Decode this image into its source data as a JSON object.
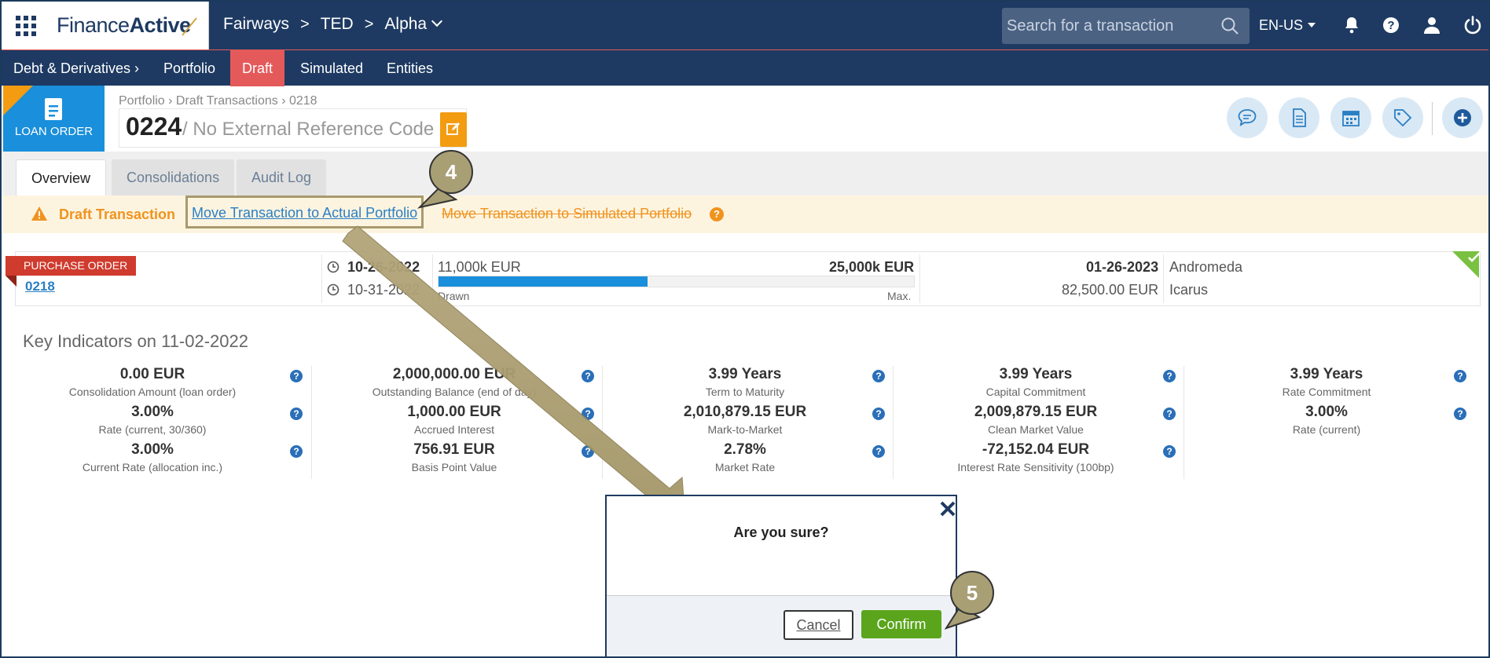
{
  "header": {
    "logo": {
      "finance": "Finance",
      "active": "Active"
    },
    "breadcrumb": [
      "Fairways",
      "TED",
      "Alpha"
    ],
    "search_placeholder": "Search for a transaction",
    "language": "EN-US"
  },
  "nav": {
    "items": [
      {
        "label": "Debt & Derivatives ›"
      },
      {
        "label": "Portfolio"
      },
      {
        "label": "Draft"
      },
      {
        "label": "Simulated"
      },
      {
        "label": "Entities"
      }
    ],
    "active": "Draft"
  },
  "page": {
    "type_label": "LOAN ORDER",
    "breadcrumb": "Portfolio › Draft Transactions ›  0218",
    "number": "0224",
    "reference": "/ No External Reference Code"
  },
  "tabs": [
    {
      "label": "Overview"
    },
    {
      "label": "Consolidations"
    },
    {
      "label": "Audit Log"
    }
  ],
  "active_tab": "Overview",
  "draft_banner": {
    "label": "Draft Transaction",
    "move_actual": "Move Transaction to Actual Portfolio",
    "move_simulated": "Move Transaction to Simulated Portfolio"
  },
  "purchase_order": {
    "ribbon": "PURCHASE ORDER",
    "number": "0218",
    "start_date": "10-26-2022",
    "second_date": "10-31-2022",
    "drawn_amount": "11,000k EUR",
    "max_amount": "25,000k EUR",
    "drawn_label": "Drawn",
    "max_label": "Max.",
    "drawn_fraction": 0.44,
    "end_date": "01-26-2023",
    "amount": "82,500.00 EUR",
    "entity_1": "Andromeda",
    "entity_2": "Icarus"
  },
  "key_indicators": {
    "title": "Key Indicators on 11-02-2022",
    "columns": [
      [
        {
          "value": "0.00 EUR",
          "label": "Consolidation Amount (loan order)"
        },
        {
          "value": "3.00%",
          "label": "Rate (current, 30/360)"
        },
        {
          "value": "3.00%",
          "label": "Current Rate (allocation inc.)"
        }
      ],
      [
        {
          "value": "2,000,000.00 EUR",
          "label": "Outstanding Balance (end of day)"
        },
        {
          "value": "1,000.00 EUR",
          "label": "Accrued Interest"
        },
        {
          "value": "756.91 EUR",
          "label": "Basis Point Value"
        }
      ],
      [
        {
          "value": "3.99 Years",
          "label": "Term to Maturity"
        },
        {
          "value": "2,010,879.15 EUR",
          "label": "Mark-to-Market"
        },
        {
          "value": "2.78%",
          "label": "Market Rate"
        }
      ],
      [
        {
          "value": "3.99 Years",
          "label": "Capital Commitment"
        },
        {
          "value": "2,009,879.15 EUR",
          "label": "Clean Market Value"
        },
        {
          "value": "-72,152.04 EUR",
          "label": "Interest Rate Sensitivity (100bp)"
        }
      ],
      [
        {
          "value": "3.99 Years",
          "label": "Rate Commitment"
        },
        {
          "value": "3.00%",
          "label": "Rate (current)"
        }
      ]
    ]
  },
  "modal": {
    "title": "Are you sure?",
    "cancel": "Cancel",
    "confirm": "Confirm"
  },
  "callouts": {
    "step_4": "4",
    "step_5": "5"
  },
  "icons": {
    "apps": "apps-grid-icon",
    "search": "search-icon",
    "bell": "bell-icon",
    "help": "help-icon",
    "user": "user-icon",
    "power": "power-icon",
    "edit": "edit-icon",
    "comment": "comment-icon",
    "document": "document-icon",
    "calendar": "calendar-icon",
    "tag": "tag-icon",
    "add": "add-icon",
    "close": "close-icon"
  },
  "colors": {
    "header_bg": "#1e3a62",
    "draft_active": "#e45a5b",
    "loan_order": "#1a8fdb",
    "warning": "#f0931e",
    "ribbon": "#cf3b2d",
    "confirm": "#5aa51b",
    "callout": "#a99f75"
  }
}
